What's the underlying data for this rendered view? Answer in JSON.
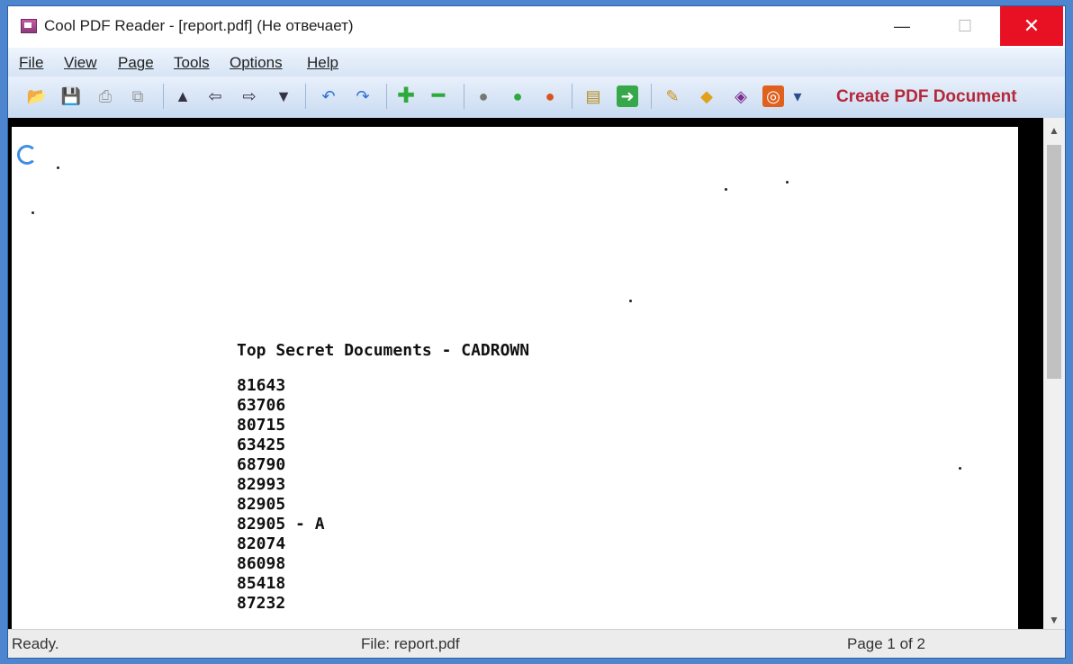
{
  "window": {
    "title": "Cool PDF Reader - [report.pdf] (Не отвечает)",
    "controls": {
      "minimize": "—",
      "maximize": "☐",
      "close": "✕"
    }
  },
  "menu": [
    "File",
    "View",
    "Page",
    "Tools",
    "Options",
    "Help"
  ],
  "toolbar": {
    "icons": [
      "open-icon",
      "save-icon",
      "print-icon",
      "copy-icon",
      "page-up-icon",
      "back-icon",
      "forward-icon",
      "page-down-icon",
      "rotate-left-icon",
      "rotate-right-icon",
      "zoom-in-icon",
      "zoom-out-icon",
      "zoom-fit-icon",
      "zoom-actual-icon",
      "zoom-stop-icon",
      "extract-text-icon",
      "export-icon",
      "settings-icon",
      "info-icon",
      "book-icon",
      "pdf-icon",
      "dropdown-icon"
    ],
    "create_pdf_label": "Create PDF Document"
  },
  "document": {
    "heading": "Top Secret Documents - CADROWN",
    "entries": [
      "81643",
      "63706",
      "80715",
      "63425",
      "68790",
      "82993",
      "82905",
      "82905 - A",
      "82074",
      "86098",
      "85418",
      "87232"
    ]
  },
  "status": {
    "ready": "Ready.",
    "file": "File: report.pdf",
    "page": "Page 1 of 2"
  },
  "colors": {
    "accent": "#b5283a",
    "close": "#e81123",
    "desktop": "#4d86cf"
  }
}
